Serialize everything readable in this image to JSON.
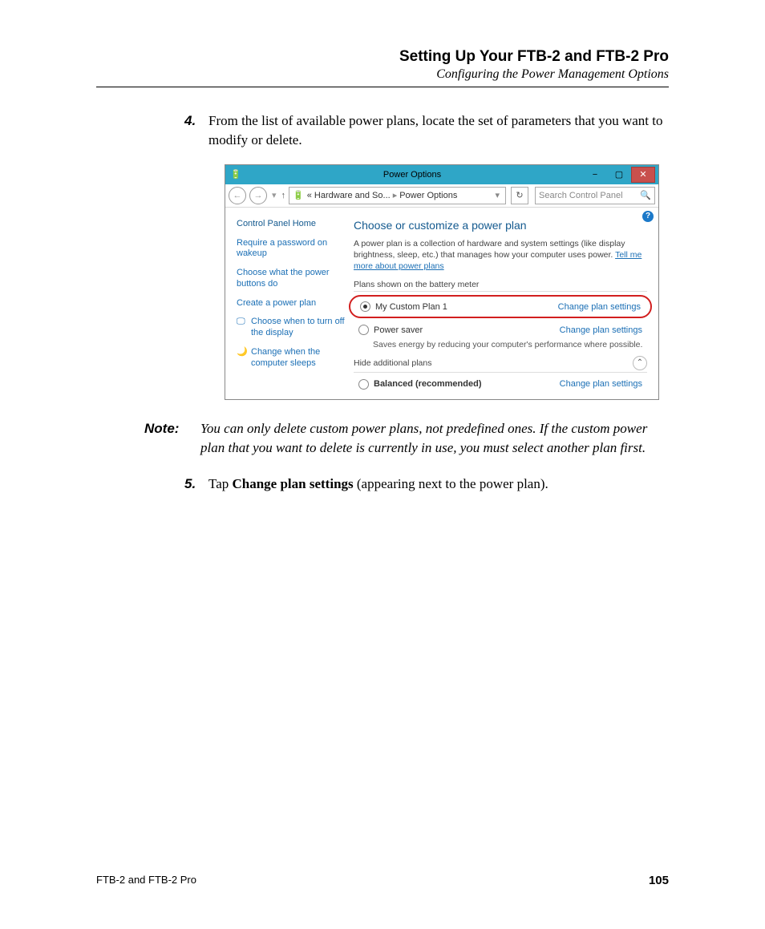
{
  "header": {
    "title": "Setting Up Your FTB-2 and FTB-2 Pro",
    "subtitle": "Configuring the Power Management Options"
  },
  "steps": {
    "s4_num": "4.",
    "s4_text": "From the list of available power plans, locate the set of parameters that you want to modify or delete.",
    "s5_num": "5.",
    "s5_pre": "Tap ",
    "s5_bold": "Change plan settings",
    "s5_post": " (appearing next to the power plan)."
  },
  "note": {
    "label": "Note:",
    "text": "You can only delete custom power plans, not predefined ones. If the custom power plan that you want to delete is currently in use, you must select another plan first."
  },
  "screenshot": {
    "window_title": "Power Options",
    "breadcrumb": {
      "part1": "« Hardware and So...",
      "part2": "Power Options"
    },
    "search_placeholder": "Search Control Panel",
    "sidebar": {
      "home": "Control Panel Home",
      "links": [
        "Require a password on wakeup",
        "Choose what the power buttons do",
        "Create a power plan",
        "Choose when to turn off the display",
        "Change when the computer sleeps"
      ]
    },
    "main": {
      "title": "Choose or customize a power plan",
      "desc_pre": "A power plan is a collection of hardware and system settings (like display brightness, sleep, etc.) that manages how your computer uses power. ",
      "desc_link": "Tell me more about power plans",
      "plans_label": "Plans shown on the battery meter",
      "plan1": {
        "name": "My Custom Plan 1",
        "change": "Change plan settings"
      },
      "plan2": {
        "name": "Power saver",
        "change": "Change plan settings",
        "desc": "Saves energy by reducing your computer's performance where possible."
      },
      "hide_label": "Hide additional plans",
      "plan3": {
        "name": "Balanced (recommended)",
        "change": "Change plan settings"
      }
    }
  },
  "footer": {
    "left": "FTB-2 and FTB-2 Pro",
    "page": "105"
  }
}
